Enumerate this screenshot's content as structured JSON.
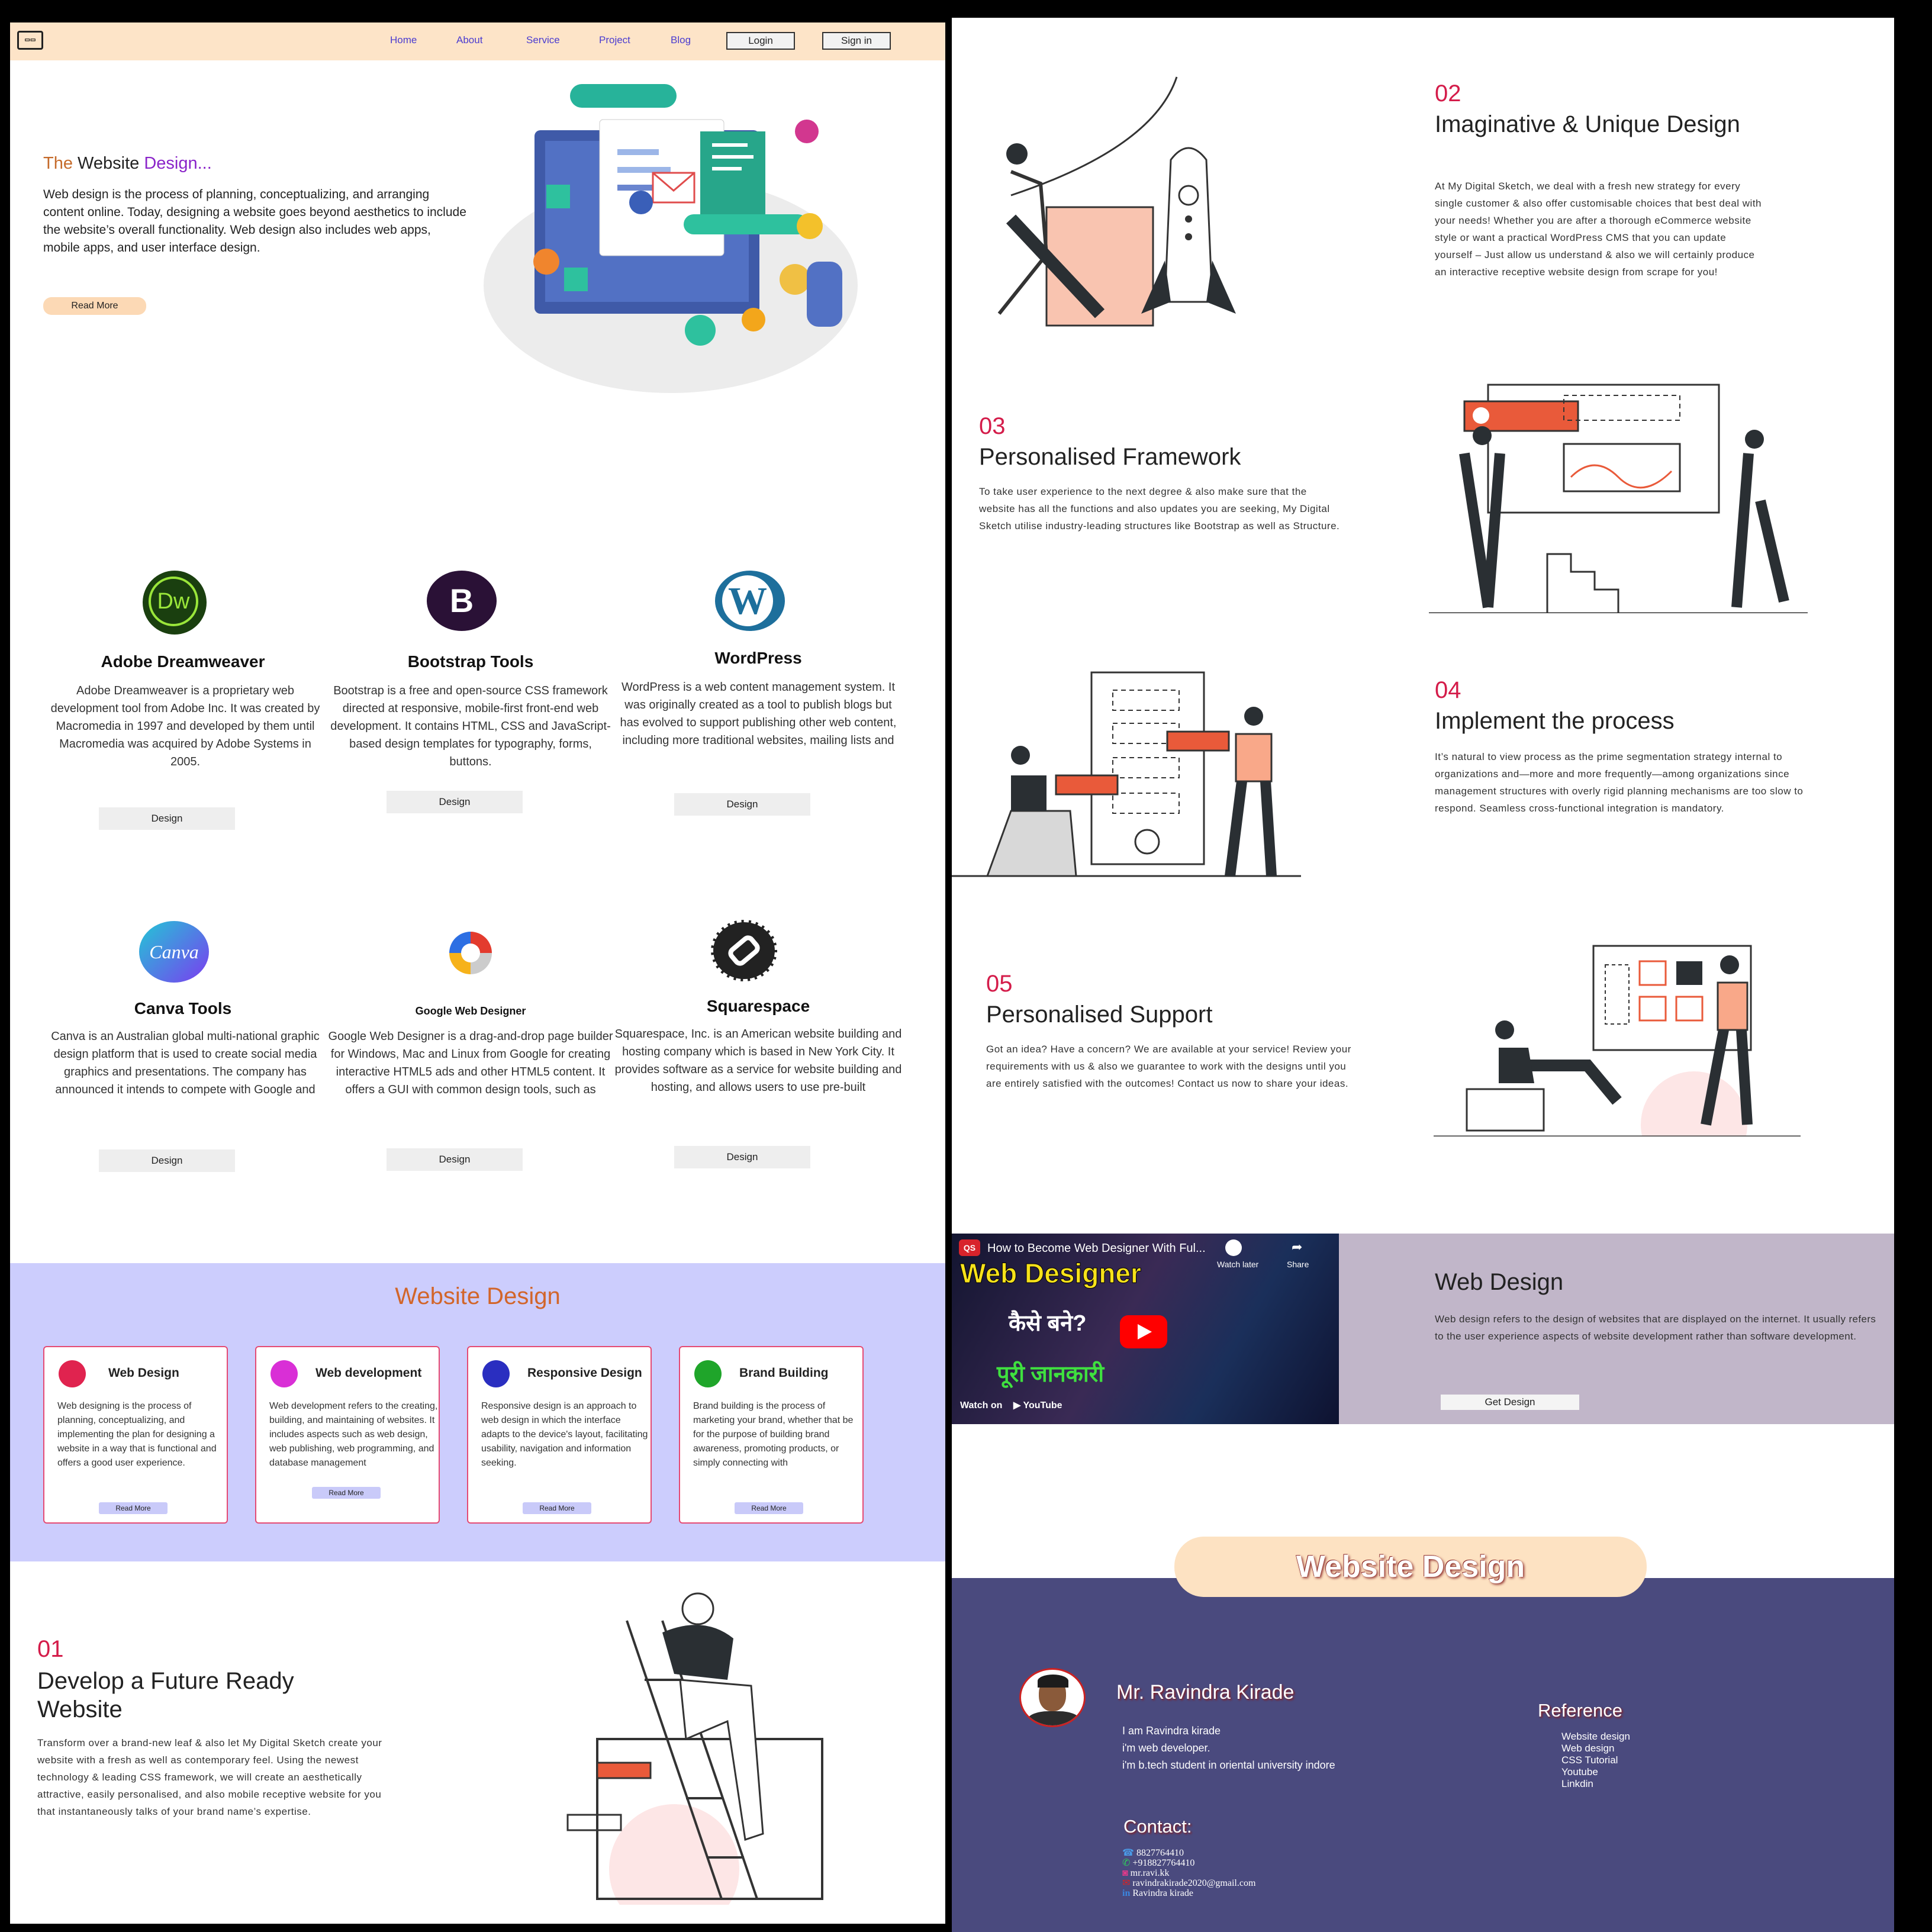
{
  "nav": {
    "home": "Home",
    "about": "About",
    "service": "Service",
    "project": "Project",
    "blog": "Blog",
    "login": "Login",
    "signin": "Sign in"
  },
  "hero": {
    "title_a": "The",
    "title_b": "Website",
    "title_c": "Design...",
    "text": "Web design is the process of planning, conceptualizing, and arranging content online. Today, designing a website goes beyond aesthetics to include the website’s overall functionality. Web design also includes web apps, mobile apps, and user interface design.",
    "button": "Read More"
  },
  "tools": [
    {
      "title": "Adobe Dreamweaver",
      "icon": "Dw",
      "text": "Adobe Dreamweaver is a proprietary web development tool from Adobe Inc. It was created by Macromedia in 1997 and developed by them until Macromedia was acquired by Adobe Systems in 2005.",
      "button": "Design"
    },
    {
      "title": "Bootstrap Tools",
      "icon": "B",
      "text": "Bootstrap is a free and open-source CSS framework directed at responsive, mobile-first front-end web development. It contains HTML, CSS and JavaScript-based design templates for typography, forms, buttons.",
      "button": "Design"
    },
    {
      "title": "WordPress",
      "icon": "W",
      "text": "WordPress is a web content management system. It was originally created as a tool to publish blogs but has evolved to support publishing other web content, including more traditional websites, mailing lists and",
      "button": "Design"
    },
    {
      "title": "Canva Tools",
      "icon": "Canva",
      "text": "Canva is an Australian global multi-national graphic design platform that is used to create social media graphics and presentations. The company has announced it intends to compete with Google and",
      "button": "Design"
    },
    {
      "title": "Google Web Designer",
      "icon": "",
      "text": "Google Web Designer is a drag-and-drop page builder for Windows, Mac and Linux from Google for creating interactive HTML5 ads and other HTML5 content. It offers a GUI with common design tools, such as",
      "button": "Design"
    },
    {
      "title": "Squarespace",
      "icon": "",
      "text": "Squarespace, Inc. is an American website building and hosting company which is based in New York City. It provides software as a service for website building and hosting, and allows users to use pre-built",
      "button": "Design"
    }
  ],
  "band": {
    "title": "Website Design",
    "cards": [
      {
        "title": "Web Design",
        "text": "Web designing is the process of planning, conceptualizing, and implementing the plan for designing a website in a way that is functional and offers a good user experience.",
        "button": "Read More",
        "color": "#e0234f"
      },
      {
        "title": "Web development",
        "text": "Web development refers to the creating, building, and maintaining of websites. It includes aspects such as web design, web publishing, web programming, and database management",
        "button": "Read More",
        "color": "#d92fd6"
      },
      {
        "title": "Responsive Design",
        "text": "Responsive design is an approach to web design in which the interface adapts to the device's layout, facilitating usability, navigation and information seeking.",
        "button": "Read More",
        "color": "#2a2ec0"
      },
      {
        "title": "Brand Building",
        "text": "Brand building is the process of marketing your brand, whether that be for the purpose of building brand awareness, promoting products, or simply connecting with",
        "button": "Read More",
        "color": "#1fa52a"
      }
    ]
  },
  "steps": [
    {
      "num": "01",
      "title": "Develop a Future Ready Website",
      "text": "Transform over a brand-new leaf & also let My Digital Sketch create your website with a fresh as well as contemporary feel. Using the newest technology & leading CSS framework, we will create an aesthetically attractive, easily personalised, and also mobile receptive website for you that instantaneously talks of your brand name’s expertise."
    },
    {
      "num": "02",
      "title": "Imaginative & Unique Design",
      "text": "At My Digital Sketch, we deal with a fresh new strategy for every single customer & also offer customisable choices that best deal with your needs! Whether you are after a thorough eCommerce website style or want a practical WordPress CMS that you can update yourself – Just allow us understand & also we will certainly produce an interactive receptive website design from scrape for you!"
    },
    {
      "num": "03",
      "title": "Personalised Framework",
      "text": "To take user experience to the next degree & also make sure that the website has all the functions and also updates you are seeking, My Digital Sketch utilise industry-leading structures like Bootstrap as well as Structure."
    },
    {
      "num": "04",
      "title": "Implement the process",
      "text": "It’s natural to view process as the prime segmentation strategy internal to organizations and—more and more frequently—among organizations since management structures with overly rigid planning mechanisms are too slow to respond. Seamless cross-functional integration is mandatory."
    },
    {
      "num": "05",
      "title": "Personalised Support",
      "text": "Got an idea? Have a concern? We are available at your service! Review your requirements with us & also we guarantee to work with the designs until you are entirely satisfied with the outcomes! Contact us now to share your ideas."
    }
  ],
  "video": {
    "title": "How to Become Web Designer With Ful...",
    "headline": "Web Designer",
    "line2": "कैसे बने?",
    "line3": "पूरी जानकारी",
    "watch_later": "Watch later",
    "share": "Share",
    "watch_on": "Watch on",
    "youtube": "YouTube",
    "badge": "QS"
  },
  "webdesign": {
    "title": "Web Design",
    "text": "Web design refers to the design of websites that are displayed on the internet. It usually refers to the user experience aspects of website development rather than software development.",
    "button": "Get Design"
  },
  "footer": {
    "pill": "Website Design",
    "name": "Mr. Ravindra Kirade",
    "about": [
      "I am Ravindra kirade",
      "i'm web developer.",
      "i'm b.tech student in oriental university indore"
    ],
    "contact_title": "Contact:",
    "contacts": [
      {
        "icon": "phone-icon",
        "text": "8827764410"
      },
      {
        "icon": "whatsapp-icon",
        "text": "+918827764410"
      },
      {
        "icon": "instagram-icon",
        "text": "mr.ravi.kk"
      },
      {
        "icon": "mail-icon",
        "text": "ravindrakirade2020@gmail.com"
      },
      {
        "icon": "linkedin-icon",
        "text": "Ravindra kirade"
      }
    ],
    "ref_title": "Reference",
    "refs": [
      "Website design",
      "Web design",
      "CSS Tutorial",
      "Youtube",
      "Linkdin"
    ]
  }
}
